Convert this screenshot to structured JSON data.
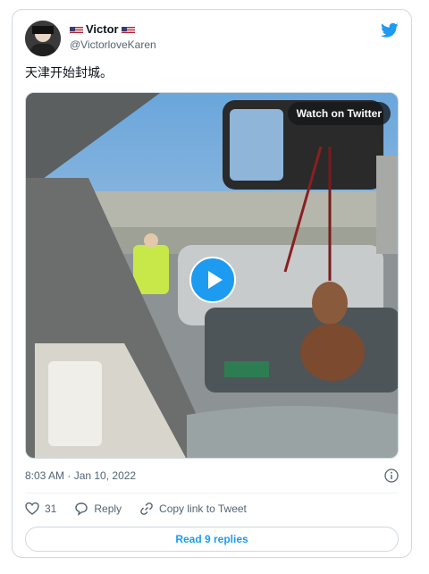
{
  "tweet": {
    "display_name": "Victor",
    "handle": "@VictorloveKaren",
    "text": "天津开始封城。",
    "timestamp": "8:03 AM · Jan 10, 2022",
    "media": {
      "watch_label": "Watch on Twitter"
    },
    "actions": {
      "like_count": "31",
      "reply_label": "Reply",
      "copy_link_label": "Copy link to Tweet"
    },
    "read_replies_label": "Read 9 replies"
  },
  "colors": {
    "brand_blue": "#1d9bf0",
    "text_secondary": "#536471",
    "border": "#cfd9de"
  },
  "icons": {
    "brand": "twitter-bird-icon",
    "info": "info-icon",
    "like": "heart-icon",
    "reply": "speech-bubble-icon",
    "copy": "link-icon",
    "play": "play-icon"
  }
}
